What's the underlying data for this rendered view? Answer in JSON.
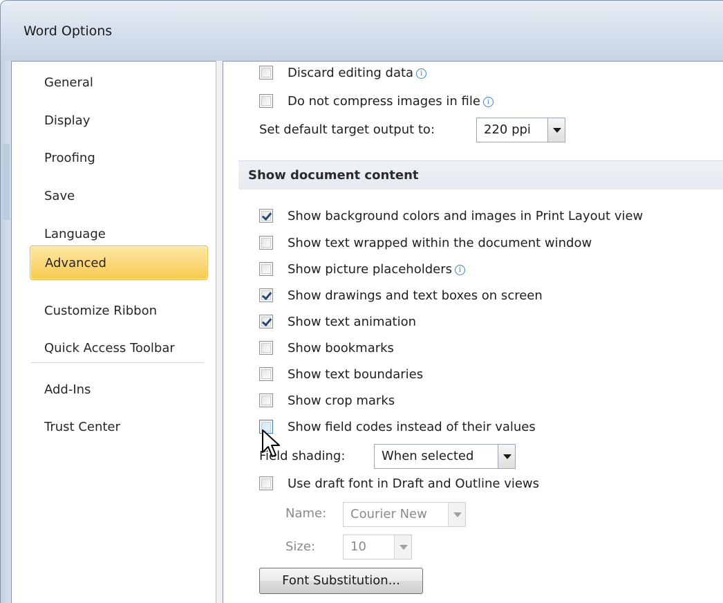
{
  "window": {
    "title": "Word Options"
  },
  "nav": {
    "items": [
      {
        "label": "General"
      },
      {
        "label": "Display"
      },
      {
        "label": "Proofing"
      },
      {
        "label": "Save"
      },
      {
        "label": "Language"
      },
      {
        "label": "Advanced",
        "selected": true
      },
      {
        "label": "Customize Ribbon"
      },
      {
        "label": "Quick Access Toolbar"
      },
      {
        "label": "Add-Ins"
      },
      {
        "label": "Trust Center"
      }
    ]
  },
  "image_options": {
    "discard_editing": {
      "label": "Discard editing data",
      "checked": false
    },
    "no_compress": {
      "label": "Do not compress images in file",
      "checked": false
    },
    "target_output_label": "Set default target output to:",
    "target_output_value": "220 ppi"
  },
  "show_document_content": {
    "heading": "Show document content",
    "options": [
      {
        "label": "Show background colors and images in Print Layout view",
        "checked": true
      },
      {
        "label": "Show text wrapped within the document window",
        "checked": false
      },
      {
        "label": "Show picture placeholders",
        "checked": false
      },
      {
        "label": "Show drawings and text boxes on screen",
        "checked": true
      },
      {
        "label": "Show text animation",
        "checked": true
      },
      {
        "label": "Show bookmarks",
        "checked": false
      },
      {
        "label": "Show text boundaries",
        "checked": false
      },
      {
        "label": "Show crop marks",
        "checked": false
      },
      {
        "label": "Show field codes instead of their values",
        "checked": false
      }
    ],
    "field_shading_label": "Field shading:",
    "field_shading_value": "When selected",
    "draft_font": {
      "label": "Use draft font in Draft and Outline views",
      "checked": false
    },
    "name_label": "Name:",
    "name_value": "Courier New",
    "size_label": "Size:",
    "size_value": "10",
    "font_substitution_button": "Font Substitution..."
  },
  "colors": {
    "selected_nav": "#f9d46a",
    "section_bg": "#e9edf2",
    "check": "#27457a",
    "info": "#3d82c9"
  }
}
